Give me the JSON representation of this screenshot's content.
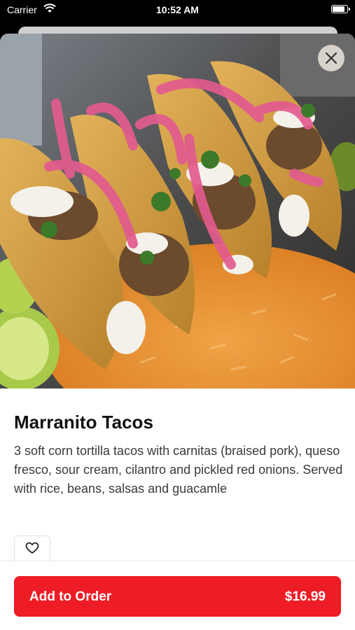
{
  "status_bar": {
    "carrier": "Carrier",
    "time": "10:52 AM",
    "battery_level": 0.9,
    "icons": [
      "wifi-icon",
      "battery-icon"
    ]
  },
  "item": {
    "image_alt": "Marranito Tacos",
    "title": "Marranito Tacos",
    "description": "3 soft corn tortilla tacos with carnitas (braised pork), queso fresco, sour cream, cilantro and pickled red onions. Served with rice, beans, salsas and guacamle"
  },
  "actions": {
    "close_icon": "close-icon",
    "favorite_icon": "heart-icon",
    "add_to_order_label": "Add to Order",
    "price": "$16.99"
  },
  "colors": {
    "accent": "#ee1c25",
    "text_primary": "#111111",
    "text_secondary": "#3a3a3a"
  }
}
